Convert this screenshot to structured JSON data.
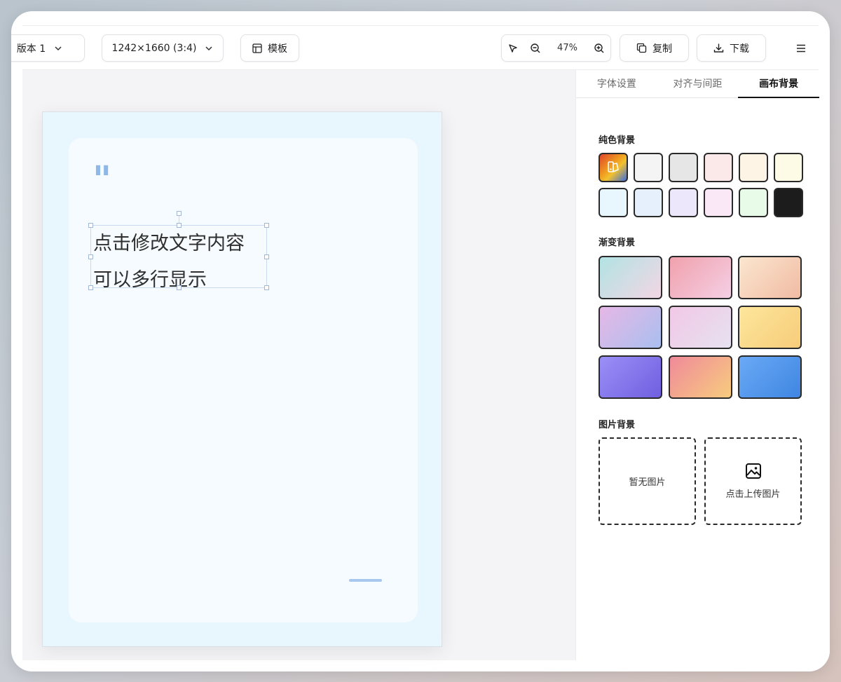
{
  "toolbar": {
    "version_select": "版本 1",
    "size_select": "1242×1660 (3:4)",
    "template_label": "模板",
    "zoom_value": "47%",
    "copy_label": "复制",
    "download_label": "下载"
  },
  "canvas": {
    "page_bg": "#e8f6fd",
    "card_bg": "#f5fbfe",
    "quote_mark": "\"",
    "text_lines": [
      "点击修改文字内容",
      "可以多行显示"
    ]
  },
  "panel": {
    "tabs": [
      {
        "label": "字体设置",
        "active": false
      },
      {
        "label": "对齐与间距",
        "active": false
      },
      {
        "label": "画布背景",
        "active": true
      }
    ],
    "solid_title": "纯色背景",
    "solid_colors": [
      "custom",
      "#f4f4f5",
      "#e6e6e7",
      "#fbe8e8",
      "#fdf4e6",
      "#fdfbe6",
      "#e8f6fd",
      "#e6effc",
      "#ede7fb",
      "#fae8f6",
      "#e8fae8",
      "#1c1c1c"
    ],
    "gradient_title": "渐变背景",
    "gradients": [
      [
        "#b2e3e3",
        "#f2d6e4"
      ],
      [
        "#f1a1ad",
        "#f4cfe4"
      ],
      [
        "#fbe6cf",
        "#f1bba3"
      ],
      [
        "#e6b8e6",
        "#a9bfef"
      ],
      [
        "#f1c8e6",
        "#e6e1f0"
      ],
      [
        "#fde69b",
        "#f7cc7a"
      ],
      [
        "#9b8ff7",
        "#6f5fe0"
      ],
      [
        "#f08a9a",
        "#f7cc7e"
      ],
      [
        "#6aa9f5",
        "#3f86e2"
      ]
    ],
    "image_title": "图片背景",
    "no_image": "暂无图片",
    "upload_label": "点击上传图片"
  }
}
